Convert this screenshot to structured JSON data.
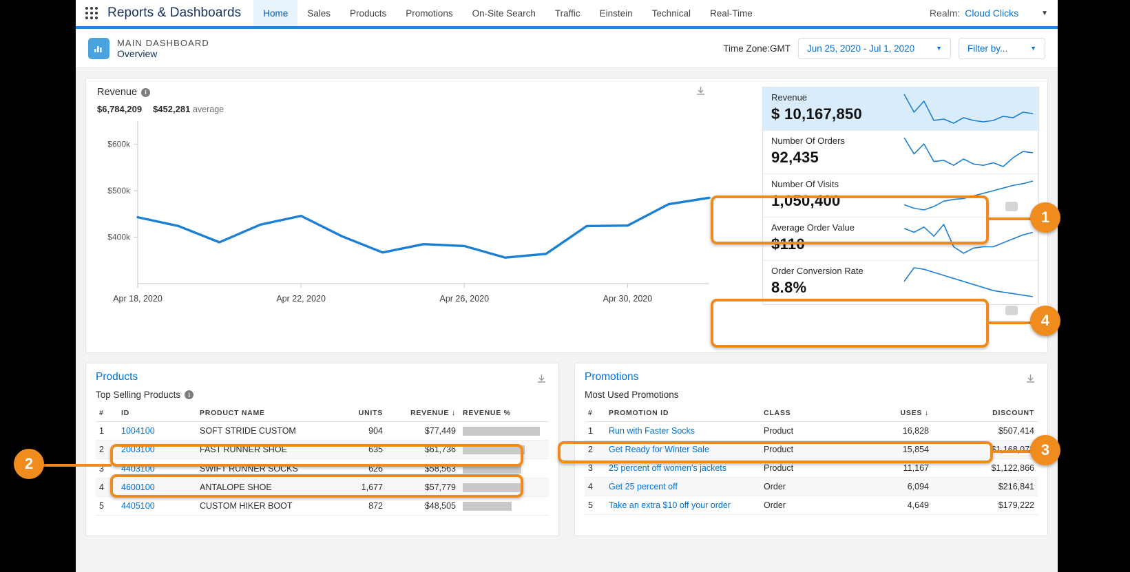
{
  "topnav": {
    "app_title": "Reports & Dashboards",
    "waffle_icon": "app-launcher-icon",
    "tabs": [
      {
        "label": "Home",
        "active": true
      },
      {
        "label": "Sales",
        "active": false
      },
      {
        "label": "Products",
        "active": false
      },
      {
        "label": "Promotions",
        "active": false
      },
      {
        "label": "On-Site Search",
        "active": false
      },
      {
        "label": "Traffic",
        "active": false
      },
      {
        "label": "Einstein",
        "active": false
      },
      {
        "label": "Technical",
        "active": false
      },
      {
        "label": "Real-Time",
        "active": false
      }
    ],
    "realm_label": "Realm:",
    "realm_value": "Cloud Clicks",
    "realm_caret": "chevron-down-icon"
  },
  "dashboard_header": {
    "icon": "bar-chart-icon",
    "kicker": "MAIN DASHBOARD",
    "name": "Overview",
    "timezone": "Time Zone:GMT",
    "date_range": "Jun 25, 2020 - Jul 1, 2020",
    "filter_label": "Filter by..."
  },
  "revenue_panel": {
    "title": "Revenue",
    "info_icon": "info-icon",
    "total": "$6,784,209",
    "average": "$452,281",
    "average_word": "average",
    "download_icon": "download-icon"
  },
  "chart_data": {
    "type": "line",
    "title": "Revenue",
    "xlabel": "",
    "ylabel": "",
    "grid": false,
    "legend": "none",
    "line_color": "#1b7fd4",
    "ylim": [
      300000,
      650000
    ],
    "ytick_labels": [
      "$400k",
      "$500k",
      "$600k"
    ],
    "ytick_values": [
      400000,
      500000,
      600000
    ],
    "xtick_labels": [
      "Apr 18, 2020",
      "Apr 22, 2020",
      "Apr 26, 2020",
      "Apr 30, 2020"
    ],
    "x": [
      "Apr 18, 2020",
      "Apr 19, 2020",
      "Apr 20, 2020",
      "Apr 21, 2020",
      "Apr 22, 2020",
      "Apr 23, 2020",
      "Apr 24, 2020",
      "Apr 25, 2020",
      "Apr 26, 2020",
      "Apr 27, 2020",
      "Apr 28, 2020",
      "Apr 29, 2020",
      "Apr 30, 2020",
      "May 1, 2020"
    ],
    "values": [
      443000,
      424000,
      389000,
      427000,
      446000,
      402000,
      367000,
      385000,
      381000,
      356000,
      364000,
      424000,
      425000,
      471000,
      485000
    ]
  },
  "kpis": [
    {
      "label": "Revenue",
      "value": "$ 10,167,850",
      "selected": true,
      "spark": [
        78,
        52,
        68,
        40,
        42,
        36,
        44,
        40,
        38,
        40,
        46,
        44,
        52,
        50
      ]
    },
    {
      "label": "Number Of Orders",
      "value": "92,435",
      "selected": false,
      "spark": [
        76,
        50,
        66,
        38,
        40,
        32,
        42,
        34,
        32,
        36,
        30,
        44,
        54,
        52
      ]
    },
    {
      "label": "Number Of Visits",
      "value": "1,050,400",
      "selected": false,
      "spark": [
        38,
        30,
        26,
        34,
        46,
        50,
        52,
        58,
        64,
        70,
        76,
        82,
        86,
        92
      ]
    },
    {
      "label": "Average Order Value",
      "value": "$110",
      "selected": false,
      "spark": [
        72,
        66,
        74,
        60,
        78,
        44,
        34,
        42,
        44,
        44,
        50,
        56,
        62,
        66
      ]
    },
    {
      "label": "Order Conversion Rate",
      "value": "8.8%",
      "selected": false,
      "spark": [
        58,
        76,
        74,
        70,
        66,
        62,
        58,
        54,
        50,
        46,
        44,
        42,
        40,
        38
      ]
    }
  ],
  "products_panel": {
    "title": "Products",
    "subtitle": "Top Selling Products",
    "info_icon": "info-icon",
    "download_icon": "download-icon",
    "columns": [
      "#",
      "ID",
      "PRODUCT NAME",
      "UNITS",
      "REVENUE",
      "REVENUE %"
    ],
    "sorted_column": "REVENUE",
    "sort_icon": "sort-descending-arrow-icon",
    "rows": [
      {
        "rank": "1",
        "id": "1004100",
        "name": "SOFT STRIDE CUSTOM",
        "units": "904",
        "revenue": "$77,449",
        "pct": 100
      },
      {
        "rank": "2",
        "id": "2003100",
        "name": "FAST RUNNER SHOE",
        "units": "635",
        "revenue": "$61,736",
        "pct": 80
      },
      {
        "rank": "3",
        "id": "4403100",
        "name": "SWIFT RUNNER SOCKS",
        "units": "626",
        "revenue": "$58,563",
        "pct": 76
      },
      {
        "rank": "4",
        "id": "4600100",
        "name": "ANTALOPE SHOE",
        "units": "1,677",
        "revenue": "$57,779",
        "pct": 75
      },
      {
        "rank": "5",
        "id": "4405100",
        "name": "CUSTOM HIKER BOOT",
        "units": "872",
        "revenue": "$48,505",
        "pct": 63
      }
    ]
  },
  "promotions_panel": {
    "title": "Promotions",
    "subtitle": "Most Used Promotions",
    "download_icon": "download-icon",
    "columns": [
      "#",
      "PROMOTION ID",
      "CLASS",
      "USES",
      "DISCOUNT"
    ],
    "sorted_column": "USES",
    "sort_icon": "sort-descending-arrow-icon",
    "rows": [
      {
        "rank": "1",
        "id": "Run with Faster Socks",
        "class": "Product",
        "uses": "16,828",
        "discount": "$507,414"
      },
      {
        "rank": "2",
        "id": "Get Ready for Winter Sale",
        "class": "Product",
        "uses": "15,854",
        "discount": "$1,168,072"
      },
      {
        "rank": "3",
        "id": "25 percent off women's jackets",
        "class": "Product",
        "uses": "11,167",
        "discount": "$1,122,866"
      },
      {
        "rank": "4",
        "id": "Get 25 percent off",
        "class": "Order",
        "uses": "6,094",
        "discount": "$216,841"
      },
      {
        "rank": "5",
        "id": "Take an extra $10 off your order",
        "class": "Order",
        "uses": "4,649",
        "discount": "$179,222"
      }
    ]
  },
  "callouts": [
    {
      "number": "1",
      "target": "kpi-number-of-visits"
    },
    {
      "number": "2",
      "target": "products-rows-1-and-3"
    },
    {
      "number": "3",
      "target": "promotions-row-1"
    },
    {
      "number": "4",
      "target": "kpi-order-conversion-rate"
    }
  ],
  "accent_color": "#ef8a1c",
  "link_color": "#0070d2"
}
